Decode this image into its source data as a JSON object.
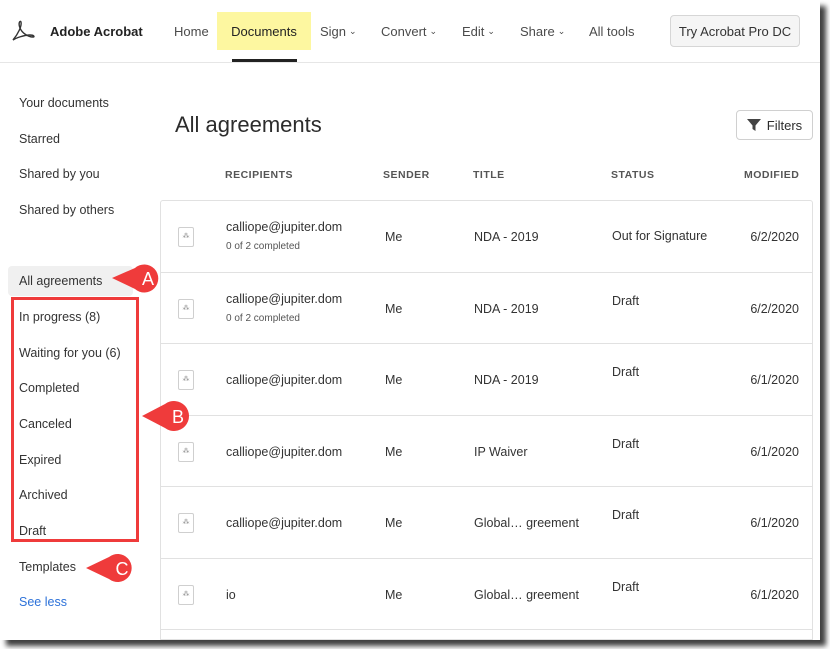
{
  "header": {
    "brand": "Adobe Acrobat",
    "nav": [
      {
        "label": "Home",
        "dropdown": false
      },
      {
        "label": "Documents",
        "dropdown": false,
        "active": true
      },
      {
        "label": "Sign",
        "dropdown": true
      },
      {
        "label": "Convert",
        "dropdown": true
      },
      {
        "label": "Edit",
        "dropdown": true
      },
      {
        "label": "Share",
        "dropdown": true
      },
      {
        "label": "All tools",
        "dropdown": false
      }
    ],
    "try_button": "Try Acrobat Pro DC"
  },
  "sidebar": {
    "items": [
      "Your documents",
      "Starred",
      "Shared by you",
      "Shared by others",
      "All agreements",
      "In progress (8)",
      "Waiting for you (6)",
      "Completed",
      "Canceled",
      "Expired",
      "Archived",
      "Draft",
      "Templates"
    ],
    "see_less": "See less",
    "selected": "All agreements"
  },
  "main": {
    "title": "All agreements",
    "filters_label": "Filters",
    "columns": [
      "RECIPIENTS",
      "SENDER",
      "TITLE",
      "STATUS",
      "MODIFIED"
    ],
    "rows": [
      {
        "recipient": "calliope@jupiter.dom",
        "progress": "0 of 2 completed",
        "sender": "Me",
        "title": "NDA - 2019",
        "status": "Out for Signature",
        "modified": "6/2/2020"
      },
      {
        "recipient": "calliope@jupiter.dom",
        "progress": "0 of 2 completed",
        "sender": "Me",
        "title": "NDA - 2019",
        "status": "Draft",
        "modified": "6/2/2020"
      },
      {
        "recipient": "calliope@jupiter.dom",
        "sender": "Me",
        "title": "NDA - 2019",
        "status": "Draft",
        "modified": "6/1/2020"
      },
      {
        "recipient": "calliope@jupiter.dom",
        "sender": "Me",
        "title": "IP Waiver",
        "status": "Draft",
        "modified": "6/1/2020"
      },
      {
        "recipient": "calliope@jupiter.dom",
        "sender": "Me",
        "title": "Global… greement",
        "status": "Draft",
        "modified": "6/1/2020"
      },
      {
        "recipient": "io",
        "sender": "Me",
        "title": "Global… greement",
        "status": "Draft",
        "modified": "6/1/2020"
      }
    ]
  },
  "callouts": [
    "A",
    "B",
    "C"
  ],
  "colors": {
    "callout": "#ef3b3b",
    "highlight": "#fdf7a0",
    "link": "#2d72d9"
  }
}
